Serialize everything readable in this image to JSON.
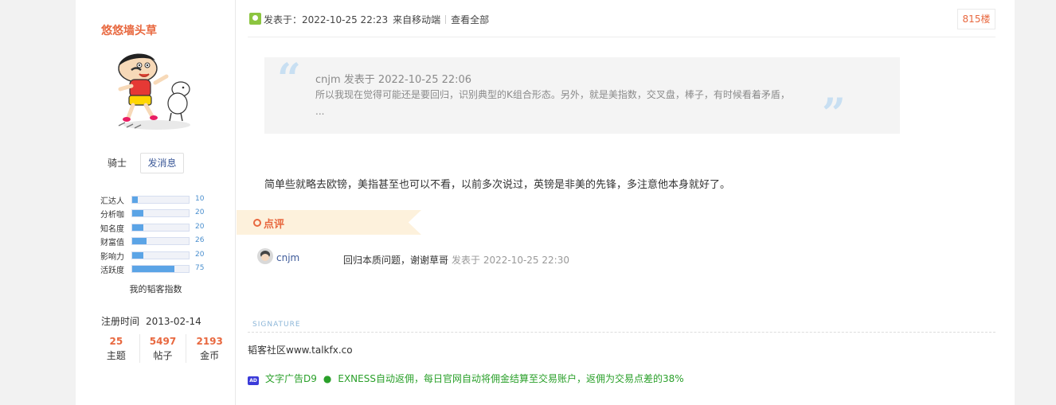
{
  "user": {
    "name": "悠悠墙头草",
    "rank": "骑士",
    "message_button": "发消息",
    "stats": [
      {
        "label": "汇达人",
        "value": "10",
        "fill": 0.1
      },
      {
        "label": "分析咖",
        "value": "20",
        "fill": 0.2
      },
      {
        "label": "知名度",
        "value": "20",
        "fill": 0.2
      },
      {
        "label": "财富值",
        "value": "26",
        "fill": 0.26
      },
      {
        "label": "影响力",
        "value": "20",
        "fill": 0.2
      },
      {
        "label": "活跃度",
        "value": "75",
        "fill": 0.75
      }
    ],
    "index_title": "我的韬客指数",
    "register_label": "注册时间",
    "register_date": "2013-02-14",
    "counts": [
      {
        "num": "25",
        "label": "主题"
      },
      {
        "num": "5497",
        "label": "帖子"
      },
      {
        "num": "2193",
        "label": "金币"
      }
    ]
  },
  "post": {
    "posted_prefix": "发表于：2022-10-25 22:23",
    "source": "来自移动端",
    "view_all": "查看全部",
    "floor": "815楼",
    "quote": {
      "meta": "cnjm 发表于 2022-10-25 22:06",
      "text": "所以我现在觉得可能还是要回归，识别典型的K组合形态。另外，就是美指数，交叉盘，棒子，有时候看着矛盾， ..."
    },
    "body": "简单些就略去欧镑，美指甚至也可以不看，以前多次说过，英镑是非美的先锋，多注意他本身就好了。",
    "review_label": "点评",
    "comment": {
      "user": "cnjm",
      "text": "回归本质问题，谢谢草哥",
      "time": "发表于 2022-10-25 22:30"
    },
    "signature_label": "SIGNATURE",
    "signature": "韬客社区www.talkfx.co",
    "ad": {
      "badge": "AD",
      "title": "文字广告D9",
      "dot": "●",
      "text": "EXNESS自动返佣，每日官网自动将佣金结算至交易账户，返佣为交易点差的38%"
    }
  },
  "colors": {
    "accent": "#e8683f",
    "link": "#3d5a99",
    "stat_fill": "#5ba4e6",
    "ad_green": "#2aa02a"
  }
}
